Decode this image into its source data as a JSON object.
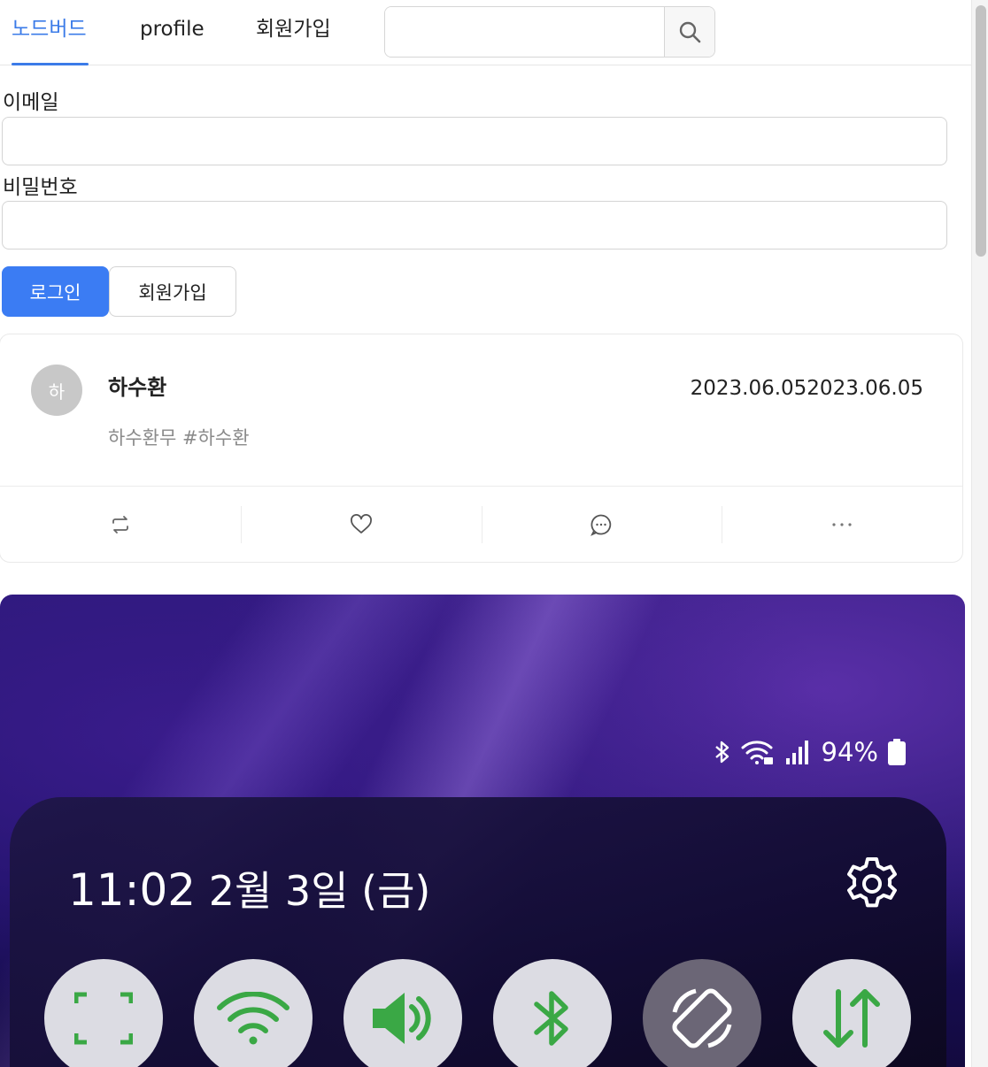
{
  "nav": {
    "tabs": [
      {
        "label": "노드버드",
        "active": true
      },
      {
        "label": "profile",
        "active": false
      },
      {
        "label": "회원가입",
        "active": false
      }
    ],
    "search": {
      "value": "",
      "placeholder": "",
      "button_icon": "search-icon"
    }
  },
  "login_form": {
    "email_label": "이메일",
    "email_value": "",
    "password_label": "비밀번호",
    "password_value": "",
    "login_button": "로그인",
    "signup_button": "회원가입"
  },
  "post": {
    "avatar_initial": "하",
    "author": "하수환",
    "date": "2023.06.052023.06.05",
    "content": "하수환무 #하수환",
    "actions": [
      "retweet-icon",
      "heart-icon",
      "comment-icon",
      "more-icon"
    ]
  },
  "phone_image": {
    "status": {
      "battery": "94%"
    },
    "clock": {
      "time": "11:02",
      "date": "2월 3일 (금)"
    },
    "quick_settings": [
      "screen-capture-icon",
      "wifi-icon",
      "sound-icon",
      "bluetooth-icon",
      "auto-rotate-icon",
      "mobile-data-icon"
    ]
  },
  "colors": {
    "accent": "#3b7be8",
    "primary_button": "#3b7cf3",
    "quick_settings_icon": "#3aa845"
  }
}
